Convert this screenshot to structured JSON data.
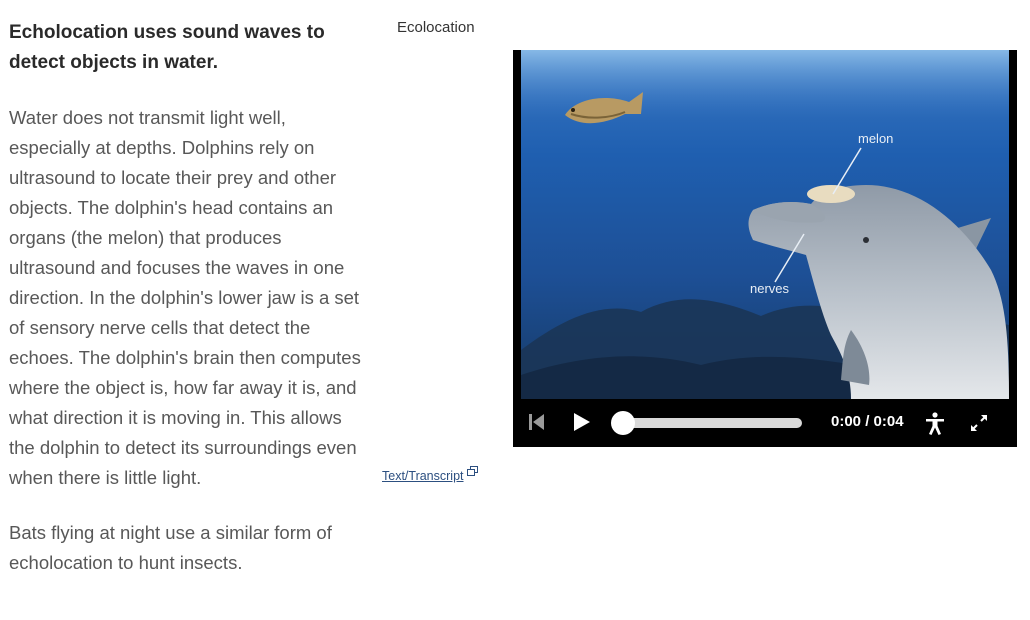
{
  "article": {
    "heading": "Echolocation uses sound waves to detect objects in water.",
    "paragraph1": "Water does not transmit light well, especially at depths. Dolphins rely on ultrasound to locate their prey and other objects. The dolphin's head contains an organs (the melon) that produces ultrasound and focuses the waves in one direction. In the dolphin's lower jaw is a set of sensory nerve cells that detect the echoes. The dolphin's brain then computes where the object is, how far away it is, and what direction it is moving in. This allows the dolphin to detect its surroundings even when there is little light.",
    "paragraph2": "Bats flying at night use a similar form of echolocation to hunt insects."
  },
  "media": {
    "title": "Ecolocation",
    "transcript_link": "Text/Transcript",
    "transcript_icon": "external-window-icon",
    "video_labels": {
      "melon": "melon",
      "nerves": "nerves"
    },
    "controls": {
      "time": "0:00 / 0:04",
      "progress": 0,
      "icons": [
        "skip-back-icon",
        "play-icon",
        "accessibility-icon",
        "fullscreen-icon"
      ]
    }
  },
  "colors": {
    "heading": "#2a2a2a",
    "body_text": "#585858",
    "link": "#2c4f80",
    "player_bg": "#000000",
    "water": "#1d5aa8"
  }
}
